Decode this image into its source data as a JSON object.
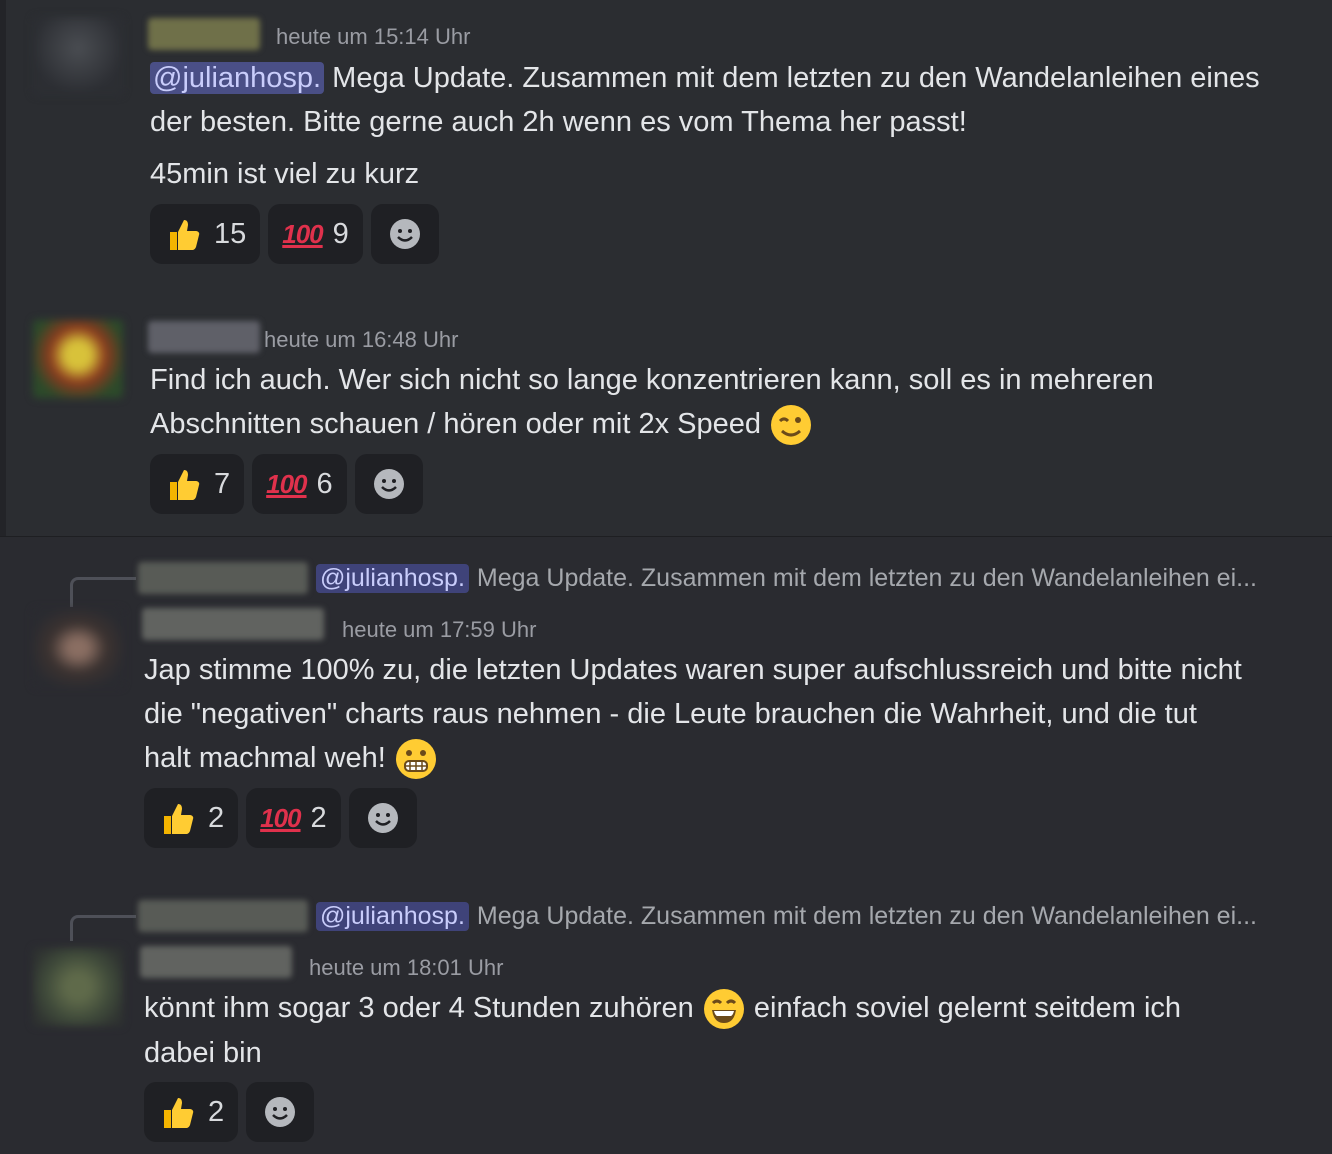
{
  "messages": [
    {
      "timestamp": "heute um 15:14 Uhr",
      "mention": "@julianhosp.",
      "line1_rest": " Mega Update. Zusammen mit dem letzten zu den Wandelanleihen eines",
      "line2": "der besten. Bitte gerne auch 2h wenn es vom Thema her passt!",
      "line3": "45min ist viel zu kurz",
      "reactions": [
        {
          "emoji": "thumbs-up",
          "count": "15"
        },
        {
          "emoji": "hundred-points",
          "count": "9"
        }
      ]
    },
    {
      "timestamp": "heute um 16:48 Uhr",
      "line1": "Find ich auch. Wer sich nicht so lange konzentrieren kann, soll es in mehreren",
      "line2": "Abschnitten schauen / hören oder mit 2x Speed",
      "reactions": [
        {
          "emoji": "thumbs-up",
          "count": "7"
        },
        {
          "emoji": "hundred-points",
          "count": "6"
        }
      ]
    },
    {
      "reply_mention": "@julianhosp.",
      "reply_text": "Mega Update. Zusammen mit dem letzten zu den Wandelanleihen ei...",
      "timestamp": "heute um 17:59 Uhr",
      "line1": "Jap stimme 100% zu, die letzten Updates waren super aufschlussreich und bitte nicht",
      "line2": "die \"negativen\" charts raus nehmen - die Leute brauchen die Wahrheit, und die tut",
      "line3": "halt machmal weh!",
      "reactions": [
        {
          "emoji": "thumbs-up",
          "count": "2"
        },
        {
          "emoji": "hundred-points",
          "count": "2"
        }
      ]
    },
    {
      "reply_mention": "@julianhosp.",
      "reply_text": "Mega Update. Zusammen mit dem letzten zu den Wandelanleihen ei...",
      "timestamp": "heute um 18:01 Uhr",
      "line1a": "könnt ihm sogar 3 oder 4 Stunden zuhören",
      "line1b": "einfach soviel gelernt seitdem ich",
      "line2": "dabei bin",
      "reactions": [
        {
          "emoji": "thumbs-up",
          "count": "2"
        }
      ]
    }
  ],
  "emoji_100_label": "100",
  "colors": {
    "background": "#2b2d31",
    "mention_bg": "#4a4f86",
    "reaction_bg": "#1f2024"
  }
}
